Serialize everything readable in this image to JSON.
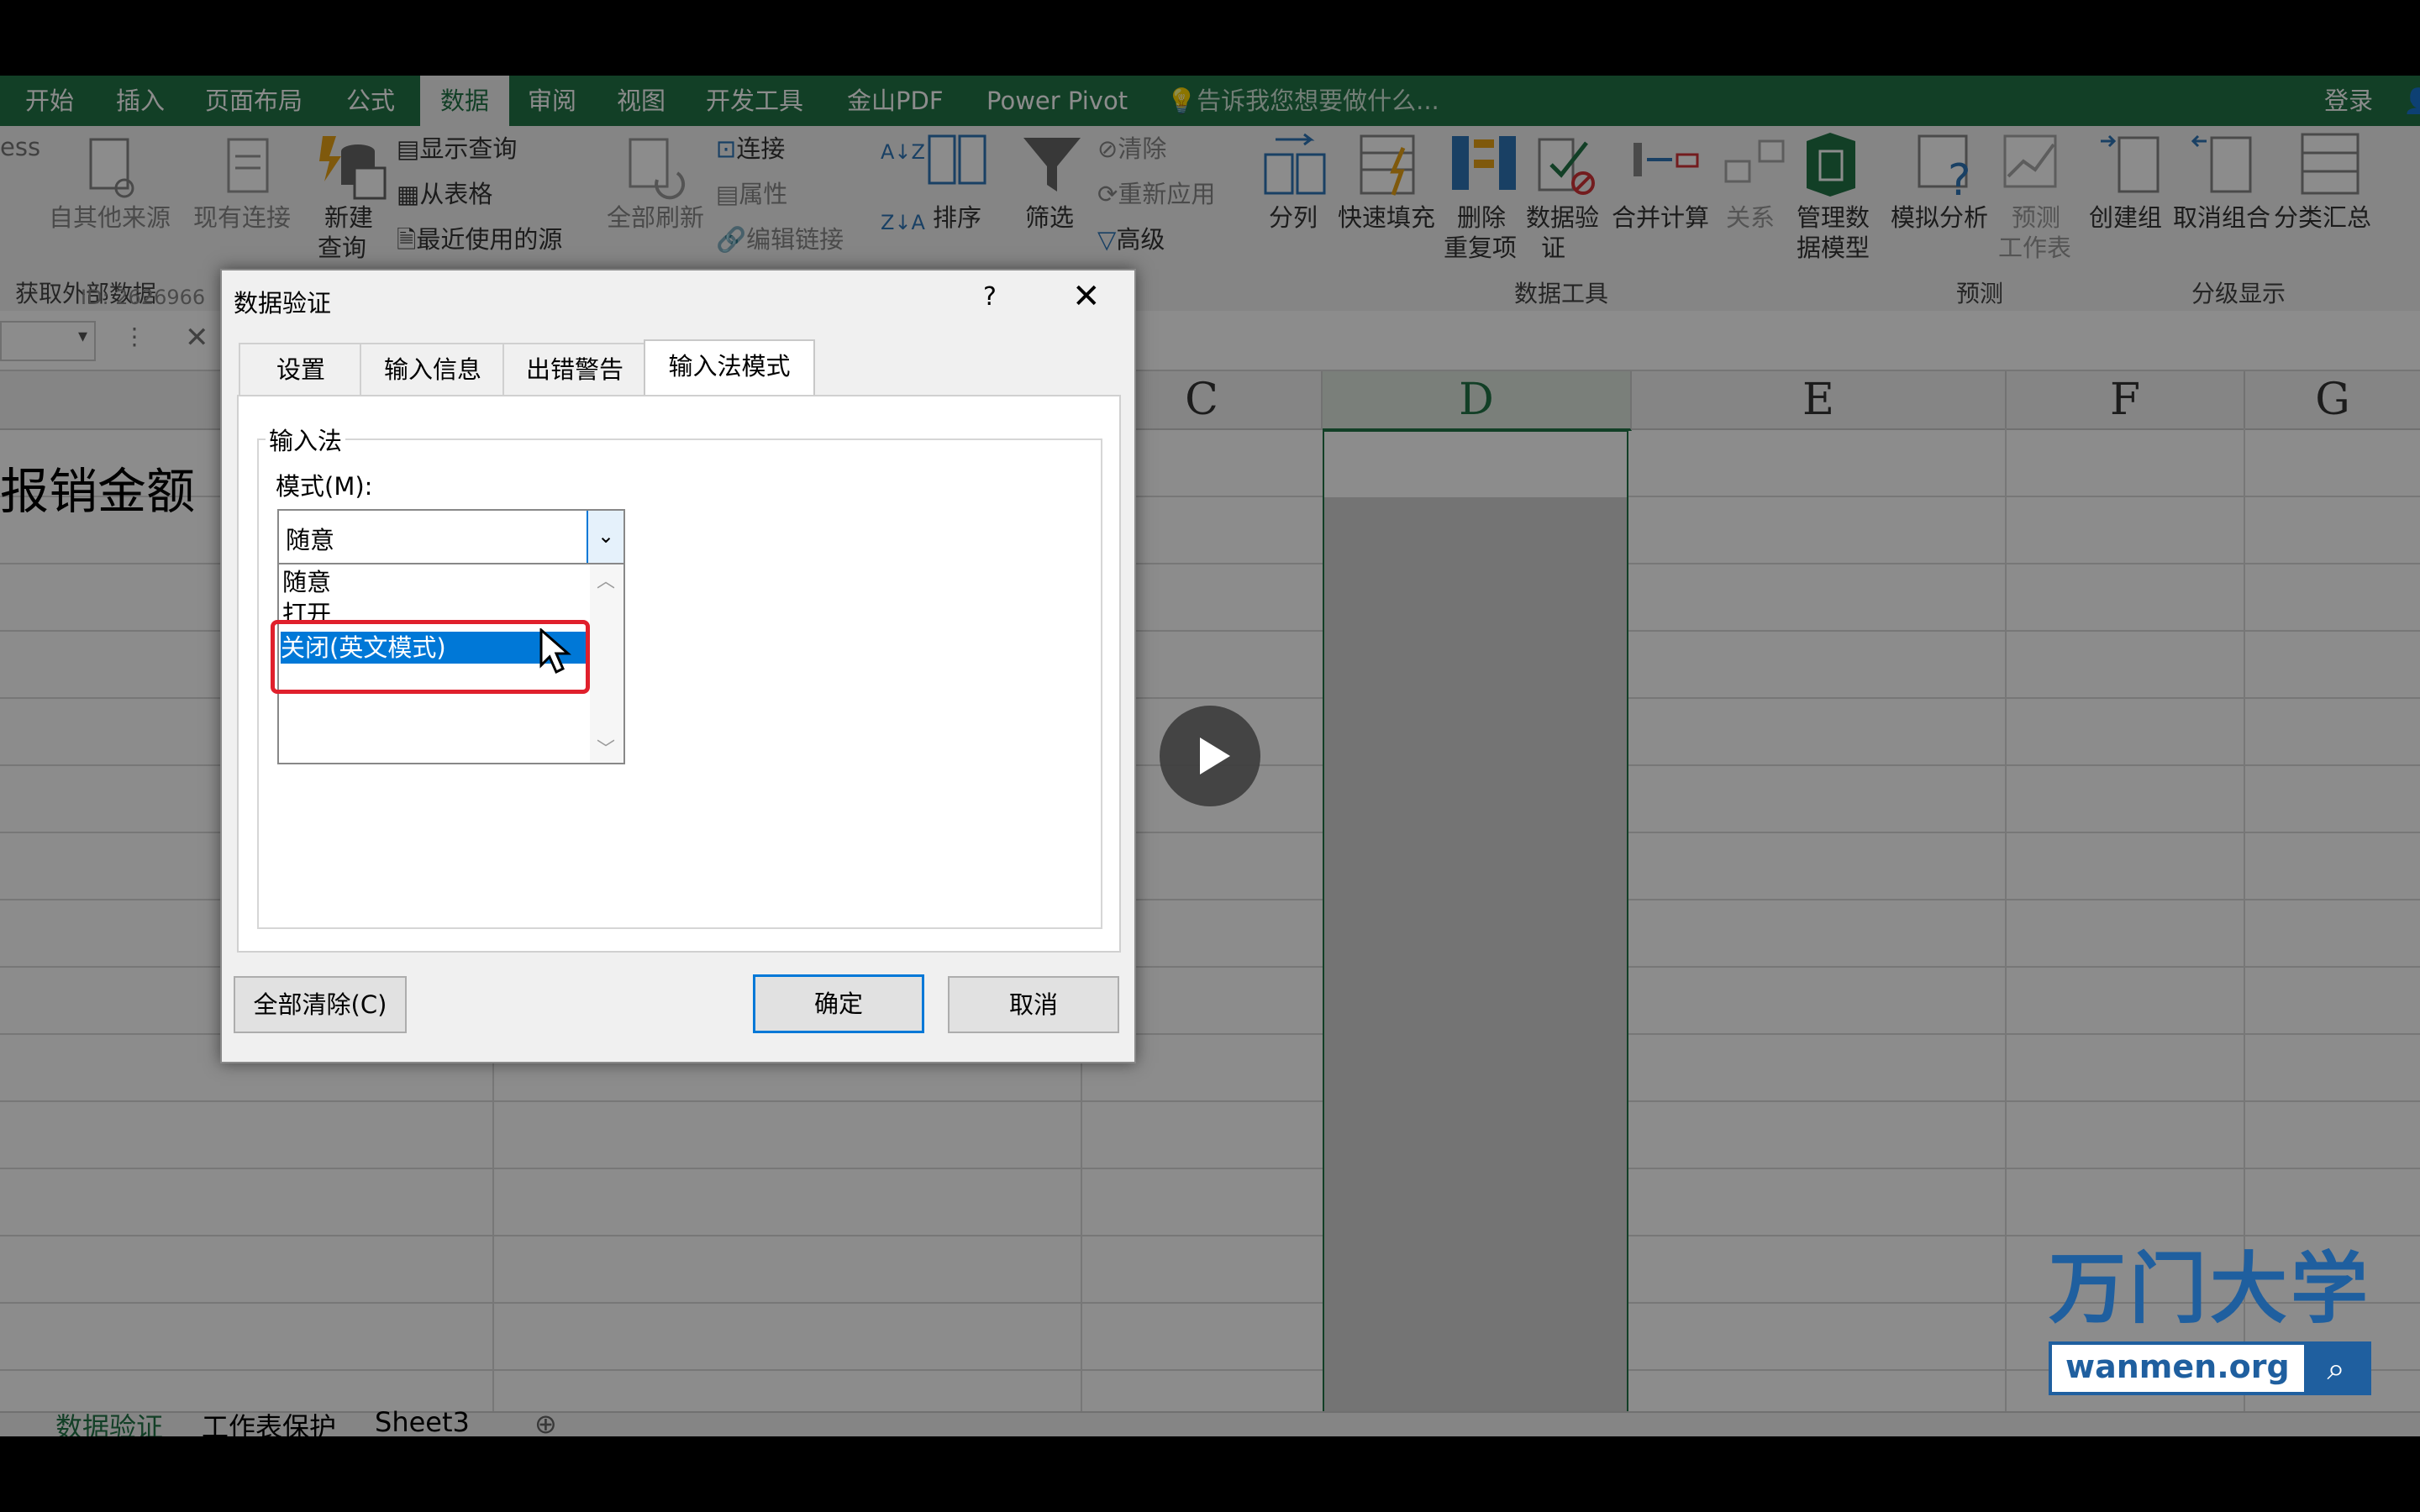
{
  "ribbon_tabs": [
    "开始",
    "插入",
    "页面布局",
    "公式",
    "数据",
    "审阅",
    "视图",
    "开发工具",
    "金山PDF",
    "Power Pivot"
  ],
  "active_tab": "数据",
  "tellme_placeholder": "告诉我您想要做什么...",
  "login_label": "登录",
  "ribbon": {
    "ess_fragment": "ess",
    "from_other": "自其他来源",
    "existing_conn": "现有连接",
    "new_query_1": "新建",
    "new_query_2": "查询",
    "show_query": "显示查询",
    "from_table": "从表格",
    "recent_sources": "最近使用的源",
    "refresh_all": "全部刷新",
    "connections": "连接",
    "properties": "属性",
    "edit_links": "编辑链接",
    "sort": "排序",
    "filter": "筛选",
    "clear": "清除",
    "reapply": "重新应用",
    "advanced": "高级",
    "text_to_columns": "分列",
    "flash_fill": "快速填充",
    "remove_dup_1": "删除",
    "remove_dup_2": "重复项",
    "validation_1": "数据验",
    "validation_2": "证",
    "consolidate": "合并计算",
    "relationships": "关系",
    "manage_model_1": "管理数",
    "manage_model_2": "据模型",
    "what_if": "模拟分析",
    "forecast_1": "预测",
    "forecast_2": "工作表",
    "group": "创建组",
    "ungroup": "取消组合",
    "subtotal": "分类汇总",
    "group_get_external": "获取外部数据",
    "group_data_tools": "数据工具",
    "group_forecast": "预测",
    "group_outline": "分级显示",
    "id_fragment": "ID: 2626966"
  },
  "columns": [
    "C",
    "D",
    "E",
    "F",
    "G"
  ],
  "cell_text": "报销金额",
  "sheet_tabs": [
    "数据验证",
    "工作表保护",
    "Sheet3"
  ],
  "dialog": {
    "title": "数据验证",
    "help": "?",
    "tabs": [
      "设置",
      "输入信息",
      "出错警告",
      "输入法模式"
    ],
    "active_tab": "输入法模式",
    "group_label": "输入法",
    "mode_label": "模式(M):",
    "selected_value": "随意",
    "options": [
      "随意",
      "打开",
      "关闭(英文模式)"
    ],
    "highlighted_option": "关闭(英文模式)",
    "clear_all": "全部清除(C)",
    "ok": "确定",
    "cancel": "取消"
  },
  "watermark": {
    "brand": "万门大学",
    "url": "wanmen.org"
  },
  "colors": {
    "excel_green": "#217346",
    "highlight_blue": "#0078d7",
    "annotation_red": "#e0202c",
    "watermark_blue": "#1f5f9f"
  }
}
